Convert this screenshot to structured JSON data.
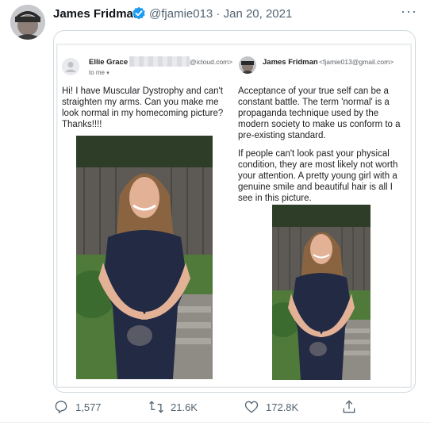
{
  "tweet": {
    "author_name": "James Fridman",
    "handle_date": "@fjamie013 · Jan 20, 2021",
    "more_icon": "more-icon"
  },
  "email_left": {
    "sender_name": "Ellie Grace",
    "sender_email_suffix": "@icloud.com>",
    "to_label": "to me",
    "body": "Hi! I have Muscular Dystrophy and can't straighten my arms. Can you make me look normal in my homecoming picture? Thanks!!!!"
  },
  "email_right": {
    "sender_name": "James Fridman",
    "sender_email": "<fjamie013@gmail.com>",
    "body_p1": "Acceptance of your true self can be a constant battle. The term 'normal' is a propaganda technique used by the modern society to make us conform to a pre-existing standard.",
    "body_p2": "If people can't look past your physical condition, they are most likely not worth your attention. A pretty young girl with a genuine smile and beautiful hair is all I see in this picture."
  },
  "actions": {
    "replies": "1,577",
    "retweets": "21.6K",
    "likes": "172.8K"
  },
  "colors": {
    "verified": "#1d9bf0",
    "muted": "#536471"
  }
}
